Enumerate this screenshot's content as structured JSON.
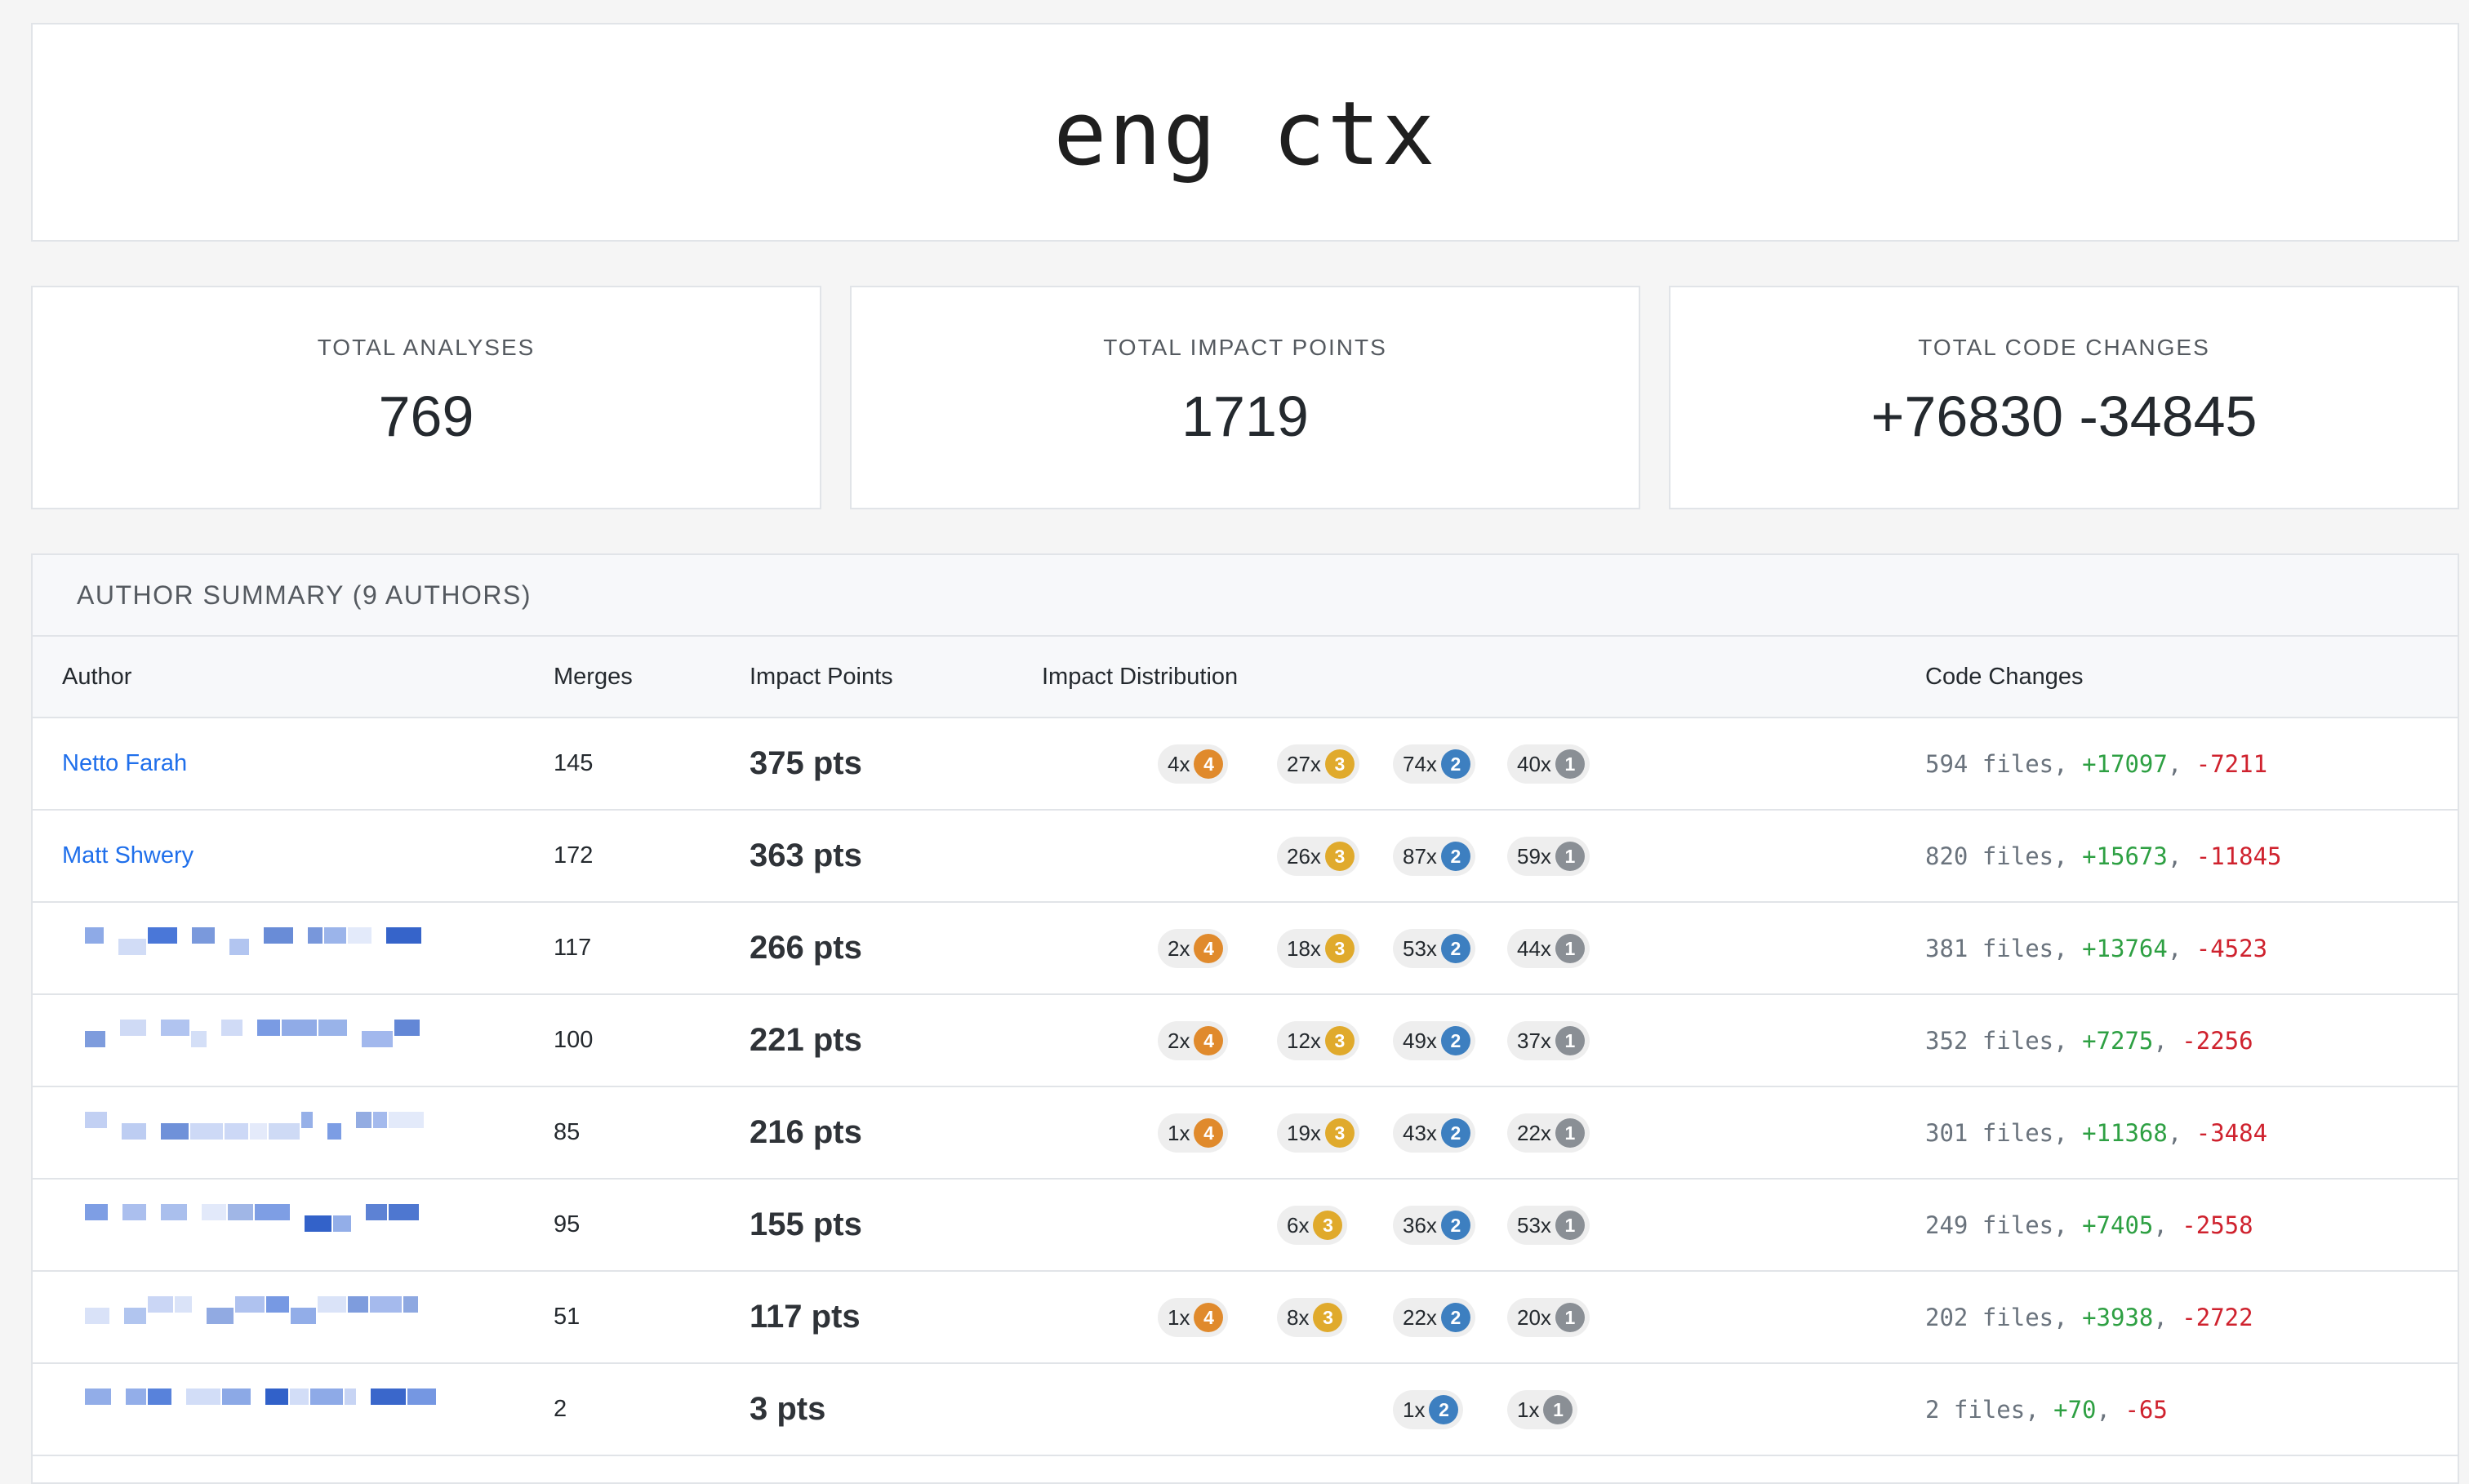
{
  "app": {
    "title": "eng ctx"
  },
  "stats": [
    {
      "label": "TOTAL ANALYSES",
      "value": "769"
    },
    {
      "label": "TOTAL IMPACT POINTS",
      "value": "1719"
    },
    {
      "label": "TOTAL CODE CHANGES",
      "value": "+76830 -34845"
    }
  ],
  "summary": {
    "title": "AUTHOR SUMMARY (9 AUTHORS)",
    "columns": {
      "author": "Author",
      "merges": "Merges",
      "points": "Impact Points",
      "distribution": "Impact Distribution",
      "code": "Code Changes"
    },
    "level_colors": {
      "4": "#e08a2c",
      "3": "#e0aa2c",
      "2": "#3d7fc0",
      "1": "#8a8f95"
    },
    "rows": [
      {
        "author": "Netto Farah",
        "author_redacted": false,
        "merges": "145",
        "points": "375 pts",
        "dist": [
          {
            "count": "4x",
            "level": "4"
          },
          {
            "count": "27x",
            "level": "3"
          },
          {
            "count": "74x",
            "level": "2"
          },
          {
            "count": "40x",
            "level": "1"
          }
        ],
        "files": "594 files",
        "adds": "+17097",
        "dels": "-7211"
      },
      {
        "author": "Matt Shwery",
        "author_redacted": false,
        "merges": "172",
        "points": "363 pts",
        "dist": [
          null,
          {
            "count": "26x",
            "level": "3"
          },
          {
            "count": "87x",
            "level": "2"
          },
          {
            "count": "59x",
            "level": "1"
          }
        ],
        "files": "820 files",
        "adds": "+15673",
        "dels": "-11845"
      },
      {
        "author": "",
        "author_redacted": true,
        "merges": "117",
        "points": "266 pts",
        "dist": [
          {
            "count": "2x",
            "level": "4"
          },
          {
            "count": "18x",
            "level": "3"
          },
          {
            "count": "53x",
            "level": "2"
          },
          {
            "count": "44x",
            "level": "1"
          }
        ],
        "files": "381 files",
        "adds": "+13764",
        "dels": "-4523"
      },
      {
        "author": "",
        "author_redacted": true,
        "merges": "100",
        "points": "221 pts",
        "dist": [
          {
            "count": "2x",
            "level": "4"
          },
          {
            "count": "12x",
            "level": "3"
          },
          {
            "count": "49x",
            "level": "2"
          },
          {
            "count": "37x",
            "level": "1"
          }
        ],
        "files": "352 files",
        "adds": "+7275",
        "dels": "-2256"
      },
      {
        "author": "",
        "author_redacted": true,
        "merges": "85",
        "points": "216 pts",
        "dist": [
          {
            "count": "1x",
            "level": "4"
          },
          {
            "count": "19x",
            "level": "3"
          },
          {
            "count": "43x",
            "level": "2"
          },
          {
            "count": "22x",
            "level": "1"
          }
        ],
        "files": "301 files",
        "adds": "+11368",
        "dels": "-3484"
      },
      {
        "author": "",
        "author_redacted": true,
        "merges": "95",
        "points": "155 pts",
        "dist": [
          null,
          {
            "count": "6x",
            "level": "3"
          },
          {
            "count": "36x",
            "level": "2"
          },
          {
            "count": "53x",
            "level": "1"
          }
        ],
        "files": "249 files",
        "adds": "+7405",
        "dels": "-2558"
      },
      {
        "author": "",
        "author_redacted": true,
        "merges": "51",
        "points": "117 pts",
        "dist": [
          {
            "count": "1x",
            "level": "4"
          },
          {
            "count": "8x",
            "level": "3"
          },
          {
            "count": "22x",
            "level": "2"
          },
          {
            "count": "20x",
            "level": "1"
          }
        ],
        "files": "202 files",
        "adds": "+3938",
        "dels": "-2722"
      },
      {
        "author": "",
        "author_redacted": true,
        "merges": "2",
        "points": "3 pts",
        "dist": [
          null,
          null,
          {
            "count": "1x",
            "level": "2"
          },
          {
            "count": "1x",
            "level": "1"
          }
        ],
        "files": "2 files",
        "adds": "+70",
        "dels": "-65"
      }
    ]
  }
}
